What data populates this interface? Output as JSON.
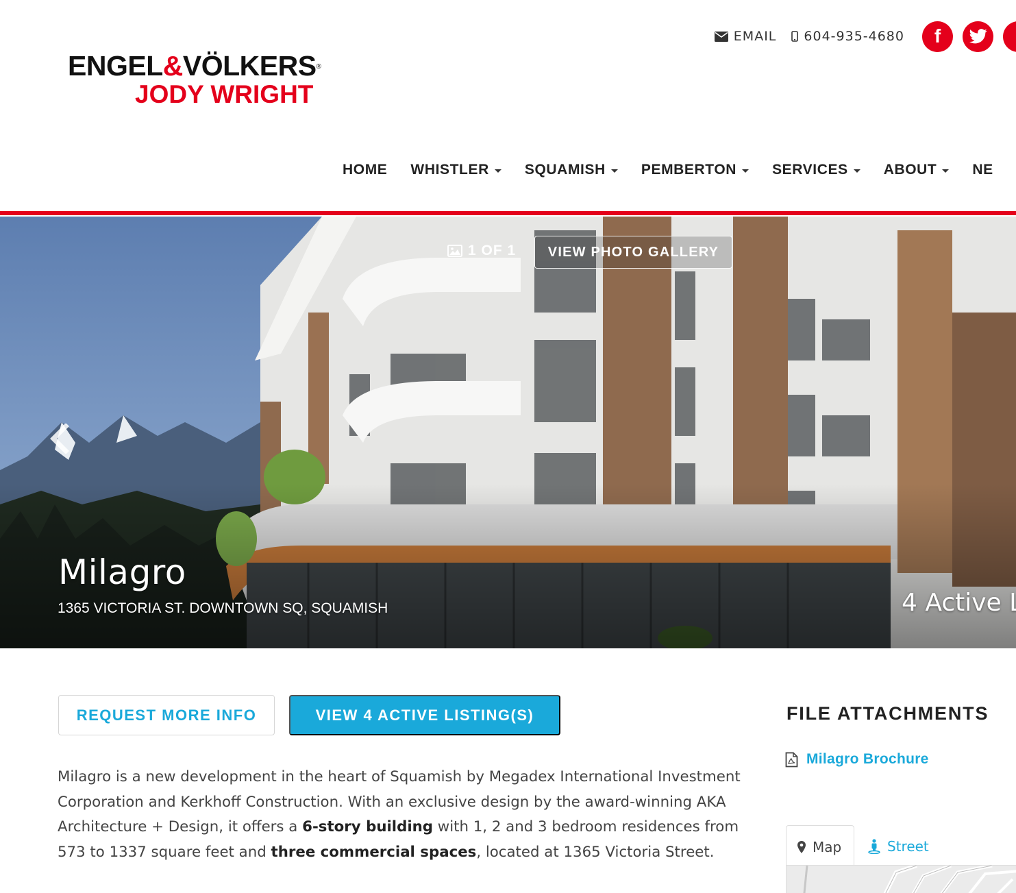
{
  "brand": {
    "top_left": "ENGEL",
    "amp": "&",
    "top_right": "VÖLKERS",
    "registered": "®",
    "agent": "JODY WRIGHT",
    "accent_color": "#e4001b"
  },
  "topbar": {
    "email_label": "EMAIL",
    "email_icon": "envelope-icon",
    "phone_label": "604-935-4680",
    "phone_icon": "mobile-phone-icon",
    "social": [
      {
        "name": "facebook",
        "glyph": "f"
      },
      {
        "name": "twitter",
        "glyph": "t"
      },
      {
        "name": "more",
        "glyph": ""
      }
    ]
  },
  "nav": {
    "items": [
      {
        "label": "HOME",
        "dropdown": false
      },
      {
        "label": "WHISTLER",
        "dropdown": true
      },
      {
        "label": "SQUAMISH",
        "dropdown": true
      },
      {
        "label": "PEMBERTON",
        "dropdown": true
      },
      {
        "label": "SERVICES",
        "dropdown": true
      },
      {
        "label": "ABOUT",
        "dropdown": true
      },
      {
        "label": "NE",
        "dropdown": false
      }
    ]
  },
  "hero": {
    "photo_count": "1 OF 1",
    "gallery_button": "VIEW PHOTO GALLERY",
    "title": "Milagro",
    "address": "1365 VICTORIA ST. DOWNTOWN SQ, SQUAMISH",
    "active_listings": "4 Active L"
  },
  "actions": {
    "request_info": "REQUEST MORE INFO",
    "view_listings": "VIEW 4 ACTIVE LISTING(S)",
    "accent_color": "#1aa9da"
  },
  "description": {
    "p1": "Milagro is a new development in the heart of Squamish by Megadex International Investment Corporation and Kerkhoff Construction. With an exclusive design by the award-winning AKA Architecture + Design, it offers a ",
    "b1": "6-story building",
    "p2": " with 1, 2 and 3 bedroom residences from 573 to 1337 square feet and ",
    "b2": "three commercial spaces",
    "p3": ", located at 1365 Victoria Street."
  },
  "sidebar": {
    "file_attachments_heading": "FILE ATTACHMENTS",
    "attachment_label": "Milagro Brochure",
    "attachment_icon": "pdf-file-icon",
    "tabs": [
      {
        "label": "Map",
        "icon": "map-marker-icon"
      },
      {
        "label": "Street",
        "icon": "street-view-icon"
      }
    ]
  }
}
